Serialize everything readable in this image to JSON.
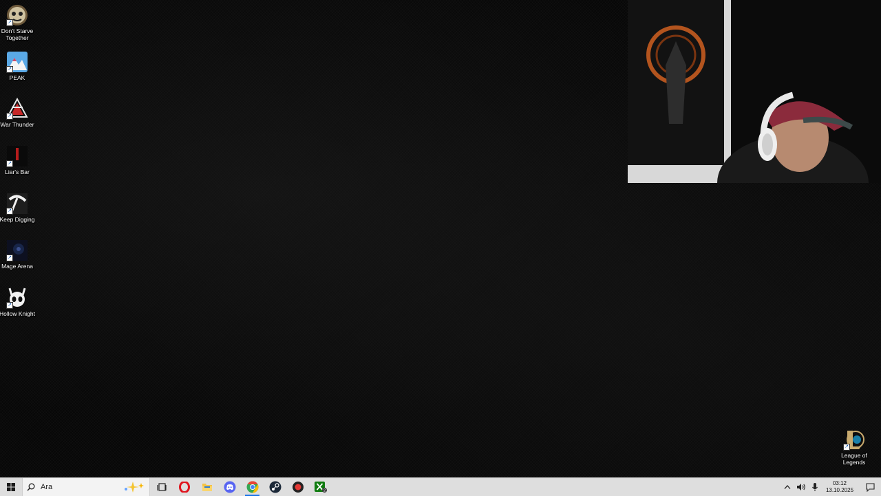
{
  "desktop": {
    "icons": [
      {
        "label": "Don't Starve Together",
        "icon": "dont-starve-together-icon"
      },
      {
        "label": "PEAK",
        "icon": "peak-icon"
      },
      {
        "label": "War Thunder",
        "icon": "war-thunder-icon"
      },
      {
        "label": "Liar's Bar",
        "icon": "liars-bar-icon"
      },
      {
        "label": "Keep Digging",
        "icon": "keep-digging-icon"
      },
      {
        "label": "Mage Arena",
        "icon": "mage-arena-icon"
      },
      {
        "label": "Hollow Knight",
        "icon": "hollow-knight-icon"
      },
      {
        "label": "League of Legends",
        "icon": "league-of-legends-icon"
      }
    ]
  },
  "webcam": {
    "icon": "webcam-overlay"
  },
  "taskbar": {
    "search_text": "Ara",
    "apps": [
      {
        "icon": "task-view-icon"
      },
      {
        "icon": "opera-icon"
      },
      {
        "icon": "file-explorer-icon"
      },
      {
        "icon": "discord-icon"
      },
      {
        "icon": "chrome-icon"
      },
      {
        "icon": "steam-icon"
      },
      {
        "icon": "record-app-icon"
      },
      {
        "icon": "xbox-icon",
        "badge": "2"
      }
    ],
    "clock": {
      "time": "03:12",
      "date": "13.10.2025"
    }
  },
  "colors": {
    "taskbar_bg": "#dedede",
    "accent": "#1a73e8"
  }
}
